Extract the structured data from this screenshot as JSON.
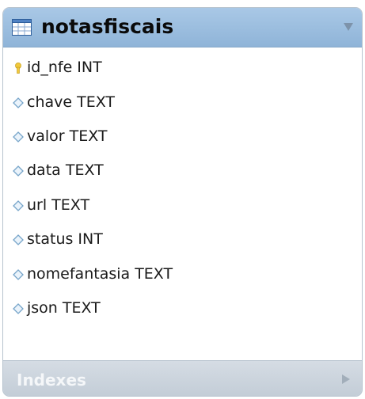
{
  "table": {
    "name": "notasfiscais",
    "icon": "table-icon",
    "collapse_icon": "triangle-down-icon"
  },
  "columns": [
    {
      "label": "id_nfe INT",
      "icon": "primary-key-icon"
    },
    {
      "label": "chave TEXT",
      "icon": "column-diamond-icon"
    },
    {
      "label": "valor TEXT",
      "icon": "column-diamond-icon"
    },
    {
      "label": "data TEXT",
      "icon": "column-diamond-icon"
    },
    {
      "label": "url TEXT",
      "icon": "column-diamond-icon"
    },
    {
      "label": "status INT",
      "icon": "column-diamond-icon"
    },
    {
      "label": "nomefantasia TEXT",
      "icon": "column-diamond-icon"
    },
    {
      "label": "json TEXT",
      "icon": "column-diamond-icon"
    }
  ],
  "indexes": {
    "label": "Indexes",
    "expand_icon": "triangle-right-icon"
  },
  "colors": {
    "header": "#9dbfe0",
    "footer": "#cbd4dd",
    "key": "#f2c93b",
    "diamond": "#76a4c9"
  }
}
